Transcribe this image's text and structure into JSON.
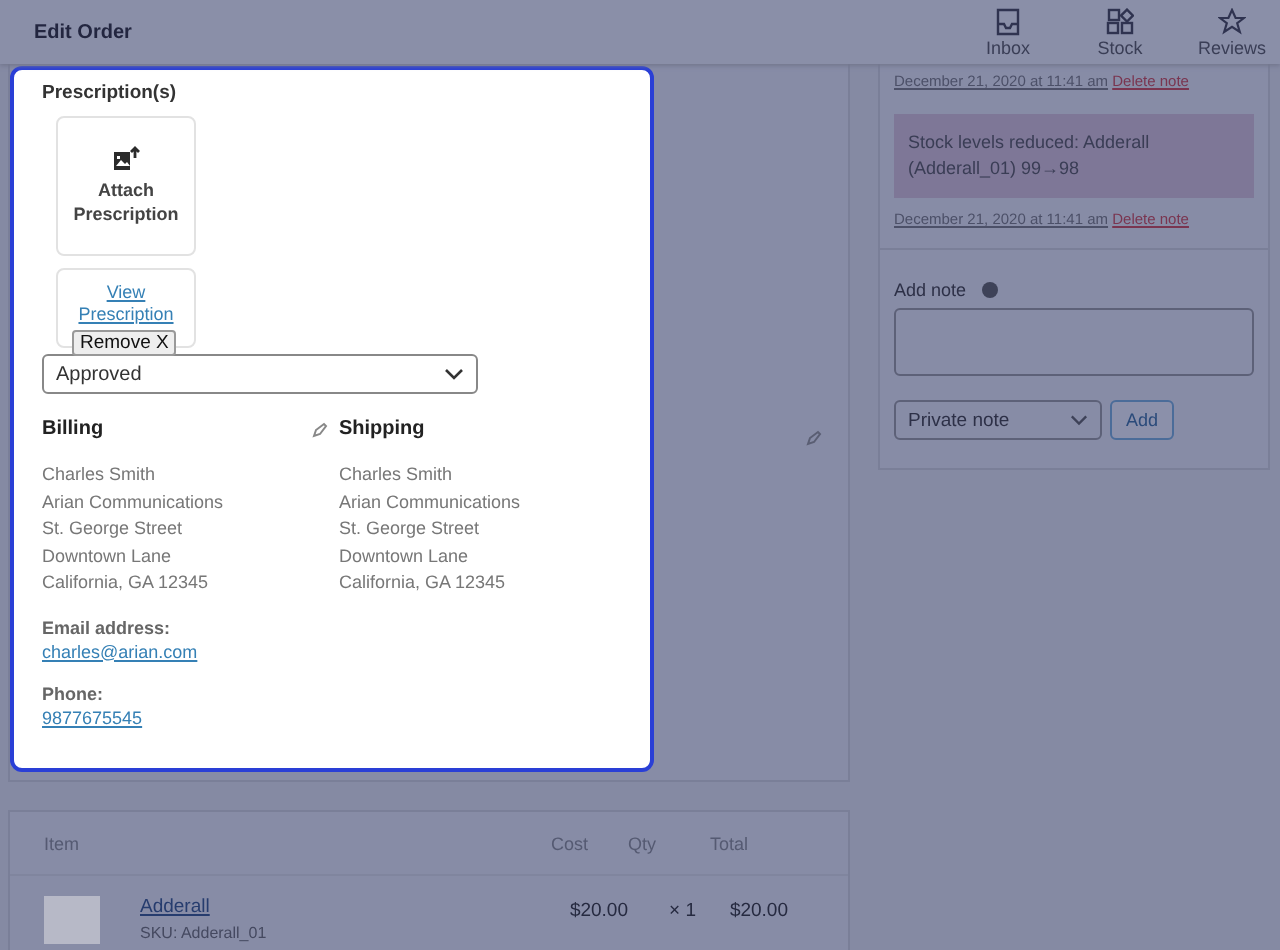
{
  "header": {
    "title": "Edit Order",
    "nav": [
      {
        "label": "Inbox",
        "kind": "inbox"
      },
      {
        "label": "Stock",
        "kind": "stock"
      },
      {
        "label": "Reviews",
        "kind": "reviews"
      }
    ]
  },
  "prescription": {
    "title": "Prescription(s)",
    "attach_label": "Attach Prescription",
    "view_link": "View Prescription",
    "remove_button": "Remove X",
    "status": "Approved"
  },
  "billing": {
    "title": "Billing",
    "lines": [
      "Charles Smith",
      "Arian Communications",
      "St. George Street",
      "Downtown Lane",
      "California, GA 12345"
    ],
    "email_label": "Email address:",
    "email": "charles@arian.com",
    "phone_label": "Phone:",
    "phone": "9877675545"
  },
  "shipping": {
    "title": "Shipping",
    "lines": [
      "Charles Smith",
      "Arian Communications",
      "St. George Street",
      "Downtown Lane",
      "California, GA 12345"
    ]
  },
  "notes": [
    {
      "date": "December 21, 2020 at 11:41 am",
      "delete": "Delete note"
    },
    {
      "text": "Stock levels reduced: Adderall (Adderall_01) 99→98",
      "date": "December 21, 2020 at 11:41 am",
      "delete": "Delete note"
    }
  ],
  "add_note": {
    "label": "Add note",
    "type": "Private note",
    "button": "Add"
  },
  "items": {
    "columns": [
      "Item",
      "Cost",
      "Qty",
      "Total"
    ],
    "rows": [
      {
        "name": "Adderall",
        "sku": "SKU: Adderall_01",
        "cost": "$20.00",
        "qty": "× 1",
        "total": "$20.00"
      }
    ]
  }
}
